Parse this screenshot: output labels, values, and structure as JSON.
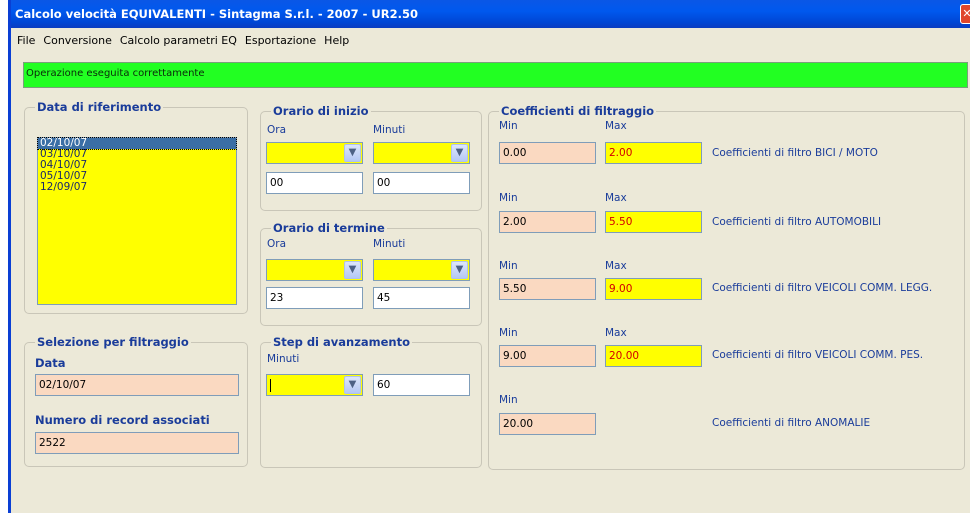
{
  "window": {
    "title": "Calcolo velocità EQUIVALENTI - Sintagma S.r.l. - 2007 - UR2.50",
    "close_glyph": "✕"
  },
  "menu": [
    "File",
    "Conversione",
    "Calcolo parametri EQ",
    "Esportazione",
    "Help"
  ],
  "status": {
    "message": "Operazione eseguita correttamente",
    "color": "#22ff22"
  },
  "data_rif": {
    "title": "Data di riferimento",
    "dates": [
      "02/10/07",
      "03/10/07",
      "04/10/07",
      "05/10/07",
      "12/09/07"
    ],
    "selected_index": 0
  },
  "orario_inizio": {
    "title": "Orario di inizio",
    "ora_label": "Ora",
    "minuti_label": "Minuti",
    "ora_value": "00",
    "minuti_value": "00"
  },
  "orario_termine": {
    "title": "Orario di termine",
    "ora_label": "Ora",
    "minuti_label": "Minuti",
    "ora_value": "23",
    "minuti_value": "45"
  },
  "selezione": {
    "title": "Selezione per filtraggio",
    "data_label": "Data",
    "data_value": "02/10/07",
    "numero_label": "Numero di record associati",
    "numero_value": "2522"
  },
  "step": {
    "title": "Step di avanzamento",
    "minuti_label": "Minuti",
    "value": "60"
  },
  "coefficienti": {
    "title": "Coefficienti di filtraggio",
    "min_label": "Min",
    "max_label": "Max",
    "rows": [
      {
        "min": "0.00",
        "max": "2.00",
        "label": "Coefficienti di filtro BICI / MOTO"
      },
      {
        "min": "2.00",
        "max": "5.50",
        "label": "Coefficienti di filtro AUTOMOBILI"
      },
      {
        "min": "5.50",
        "max": "9.00",
        "label": "Coefficienti di filtro VEICOLI COMM. LEGG."
      },
      {
        "min": "9.00",
        "max": "20.00",
        "label": "Coefficienti di filtro VEICOLI COMM. PES."
      },
      {
        "min": "20.00",
        "max": null,
        "label": "Coefficienti di filtro ANOMALIE"
      }
    ]
  },
  "icons": {
    "dropdown": "chevron-down-icon",
    "close": "close-icon"
  },
  "colors": {
    "title_bar": "#0058ee",
    "group_title": "#1a3c9a",
    "input_yellow": "#ffff00",
    "input_peach": "#fad9c1",
    "max_value_text": "#d10000"
  }
}
